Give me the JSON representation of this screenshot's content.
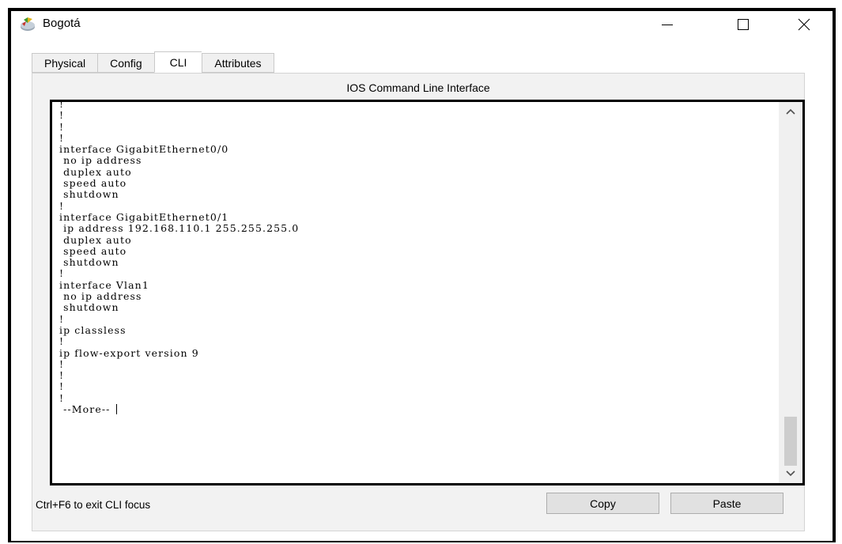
{
  "window": {
    "title": "Bogotá",
    "icon": "router-device-icon",
    "controls": [
      "minimize-icon",
      "maximize-icon",
      "close-icon"
    ]
  },
  "tabs": [
    {
      "label": "Physical",
      "active": false
    },
    {
      "label": "Config",
      "active": false
    },
    {
      "label": "CLI",
      "active": true
    },
    {
      "label": "Attributes",
      "active": false
    }
  ],
  "cli": {
    "panel_title": "IOS Command Line Interface",
    "console_lines": [
      "!",
      "!",
      "!",
      "!",
      "interface GigabitEthernet0/0",
      " no ip address",
      " duplex auto",
      " speed auto",
      " shutdown",
      "!",
      "interface GigabitEthernet0/1",
      " ip address 192.168.110.1 255.255.255.0",
      " duplex auto",
      " speed auto",
      " shutdown",
      "!",
      "interface Vlan1",
      " no ip address",
      " shutdown",
      "!",
      "ip classless",
      "!",
      "ip flow-export version 9",
      "!",
      "!",
      "!",
      "!",
      " --More-- "
    ],
    "status_text": "Ctrl+F6 to exit CLI focus",
    "copy_label": "Copy",
    "paste_label": "Paste"
  },
  "colors": {
    "window_border": "#000000",
    "panel_background": "#f2f2f2",
    "button_background": "#e1e1e1"
  }
}
